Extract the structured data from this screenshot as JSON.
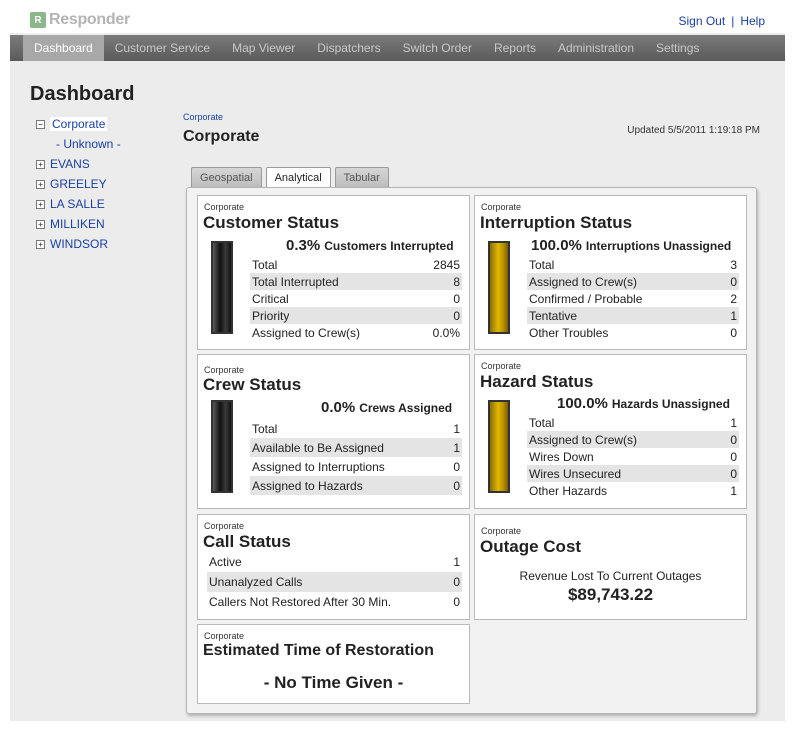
{
  "header": {
    "logo_mark": "R",
    "logo_text": "Responder",
    "sign_out": "Sign Out",
    "separator": "|",
    "help": "Help"
  },
  "nav": {
    "items": [
      {
        "label": "Dashboard"
      },
      {
        "label": "Customer Service"
      },
      {
        "label": "Map Viewer"
      },
      {
        "label": "Dispatchers"
      },
      {
        "label": "Switch Order"
      },
      {
        "label": "Reports"
      },
      {
        "label": "Administration"
      },
      {
        "label": "Settings"
      }
    ],
    "active": "Dashboard"
  },
  "page_title": "Dashboard",
  "tree": {
    "root": {
      "label": "Corporate",
      "toggle": "−"
    },
    "unknown": "- Unknown -",
    "items": [
      {
        "label": "EVANS",
        "toggle": "+"
      },
      {
        "label": "GREELEY",
        "toggle": "+"
      },
      {
        "label": "LA SALLE",
        "toggle": "+"
      },
      {
        "label": "MILLIKEN",
        "toggle": "+"
      },
      {
        "label": "WINDSOR",
        "toggle": "+"
      }
    ]
  },
  "breadcrumb": "Corporate",
  "section_title": "Corporate",
  "updated": "Updated 5/5/2011 1:19:18 PM",
  "tabs": [
    {
      "label": "Geospatial"
    },
    {
      "label": "Analytical"
    },
    {
      "label": "Tabular"
    }
  ],
  "active_tab": "Analytical",
  "colors": {
    "nav_bg": "#6b6b6b",
    "link": "#1a3fa5",
    "gold_bar": "#d4aa00",
    "black_bar": "#1a1a1a"
  },
  "customer_status": {
    "corp": "Corporate",
    "title": "Customer Status",
    "pct": "0.3%",
    "pct_label": "Customers Interrupted",
    "rows": [
      {
        "label": "Total",
        "value": "2845"
      },
      {
        "label": "Total Interrupted",
        "value": "8"
      },
      {
        "label": "Critical",
        "value": "0"
      },
      {
        "label": "Priority",
        "value": "0"
      },
      {
        "label": "Assigned to Crew(s)",
        "value": "0.0%"
      }
    ]
  },
  "interruption_status": {
    "corp": "Corporate",
    "title": "Interruption Status",
    "pct": "100.0%",
    "pct_label": "Interruptions Unassigned",
    "rows": [
      {
        "label": "Total",
        "value": "3"
      },
      {
        "label": "Assigned to Crew(s)",
        "value": "0"
      },
      {
        "label": "Confirmed / Probable",
        "value": "2"
      },
      {
        "label": "Tentative",
        "value": "1"
      },
      {
        "label": "Other Troubles",
        "value": "0"
      }
    ]
  },
  "crew_status": {
    "corp": "Corporate",
    "title": "Crew Status",
    "pct": "0.0%",
    "pct_label": "Crews Assigned",
    "rows": [
      {
        "label": "Total",
        "value": "1"
      },
      {
        "label": "Available to Be Assigned",
        "value": "1"
      },
      {
        "label": "Assigned to Interruptions",
        "value": "0"
      },
      {
        "label": "Assigned to Hazards",
        "value": "0"
      }
    ]
  },
  "hazard_status": {
    "corp": "Corporate",
    "title": "Hazard Status",
    "pct": "100.0%",
    "pct_label": "Hazards Unassigned",
    "rows": [
      {
        "label": "Total",
        "value": "1"
      },
      {
        "label": "Assigned to Crew(s)",
        "value": "0"
      },
      {
        "label": "Wires Down",
        "value": "0"
      },
      {
        "label": "Wires Unsecured",
        "value": "0"
      },
      {
        "label": "Other Hazards",
        "value": "1"
      }
    ]
  },
  "call_status": {
    "corp": "Corporate",
    "title": "Call Status",
    "rows": [
      {
        "label": "Active",
        "value": "1"
      },
      {
        "label": "Unanalyzed Calls",
        "value": "0"
      },
      {
        "label": "Callers Not Restored After 30 Min.",
        "value": "0"
      }
    ]
  },
  "outage_cost": {
    "corp": "Corporate",
    "title": "Outage Cost",
    "label": "Revenue Lost To Current Outages",
    "value": "$89,743.22"
  },
  "etr": {
    "corp": "Corporate",
    "title": "Estimated Time of Restoration",
    "value": "- No Time Given -"
  }
}
